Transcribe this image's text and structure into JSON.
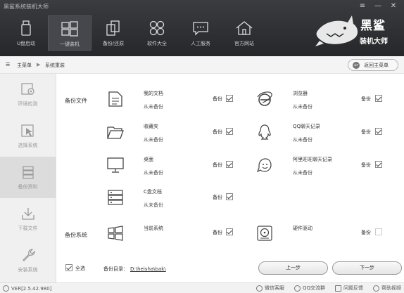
{
  "app": {
    "title": "黑鲨系统装机大师"
  },
  "window_buttons": [
    "≡",
    "—",
    "✕"
  ],
  "nav": [
    {
      "label": "U盘启动",
      "icon": "usb-drive-icon",
      "active": false
    },
    {
      "label": "一键装机",
      "icon": "windows-icon",
      "active": true
    },
    {
      "label": "备份/还原",
      "icon": "copy-icon",
      "active": false
    },
    {
      "label": "软件大全",
      "icon": "apps-grid-icon",
      "active": false
    },
    {
      "label": "人工服务",
      "icon": "chat-icon",
      "active": false
    },
    {
      "label": "官方网站",
      "icon": "home-icon",
      "active": false
    }
  ],
  "brand": {
    "line1": "黑鲨",
    "line2": "装机大师"
  },
  "breadcrumb": {
    "root": "主菜单",
    "current": "系统重装",
    "back_button": "返回主菜单"
  },
  "sidebar": [
    {
      "label": "环境检测",
      "icon": "environment-check-icon",
      "active": false
    },
    {
      "label": "选择系统",
      "icon": "cursor-select-icon",
      "active": false
    },
    {
      "label": "备份资料",
      "icon": "database-icon",
      "active": true
    },
    {
      "label": "下载文件",
      "icon": "download-icon",
      "active": false
    },
    {
      "label": "安装系统",
      "icon": "wrench-icon",
      "active": false
    }
  ],
  "sections": {
    "files": "备份文件",
    "system": "备份系统"
  },
  "backup_word": "备份",
  "items": {
    "my_documents": {
      "name": "我的文档",
      "status": "从未备份",
      "checked": true
    },
    "browser": {
      "name": "浏览器",
      "status": "从未备份",
      "checked": true
    },
    "favorites": {
      "name": "收藏夹",
      "status": "从未备份",
      "checked": true
    },
    "qq_chat": {
      "name": "QQ聊天记录",
      "status": "从未备份",
      "checked": true
    },
    "desktop": {
      "name": "桌面",
      "status": "从未备份",
      "checked": true
    },
    "aliwangwang": {
      "name": "阿里旺旺聊天记录",
      "status": "从未备份",
      "checked": true
    },
    "c_drive": {
      "name": "C盘文档",
      "status": "从未备份",
      "checked": true
    },
    "current_system": {
      "name": "当前系统",
      "checked": true
    },
    "hardware_driver": {
      "name": "硬件驱动",
      "checked": false
    }
  },
  "footer": {
    "select_all": "全选",
    "backup_dir_label": "备份目录：",
    "backup_dir_path": "D:\\heisha\\bak\\",
    "prev_button": "上一步",
    "next_button": "下一步"
  },
  "statusbar": {
    "version": "VER[2.5.42.980]",
    "links": [
      {
        "label": "微信客服",
        "icon": "wechat-icon"
      },
      {
        "label": "QQ交流群",
        "icon": "qq-icon"
      },
      {
        "label": "问题反馈",
        "icon": "feedback-icon"
      },
      {
        "label": "帮助视频",
        "icon": "help-icon"
      }
    ]
  }
}
